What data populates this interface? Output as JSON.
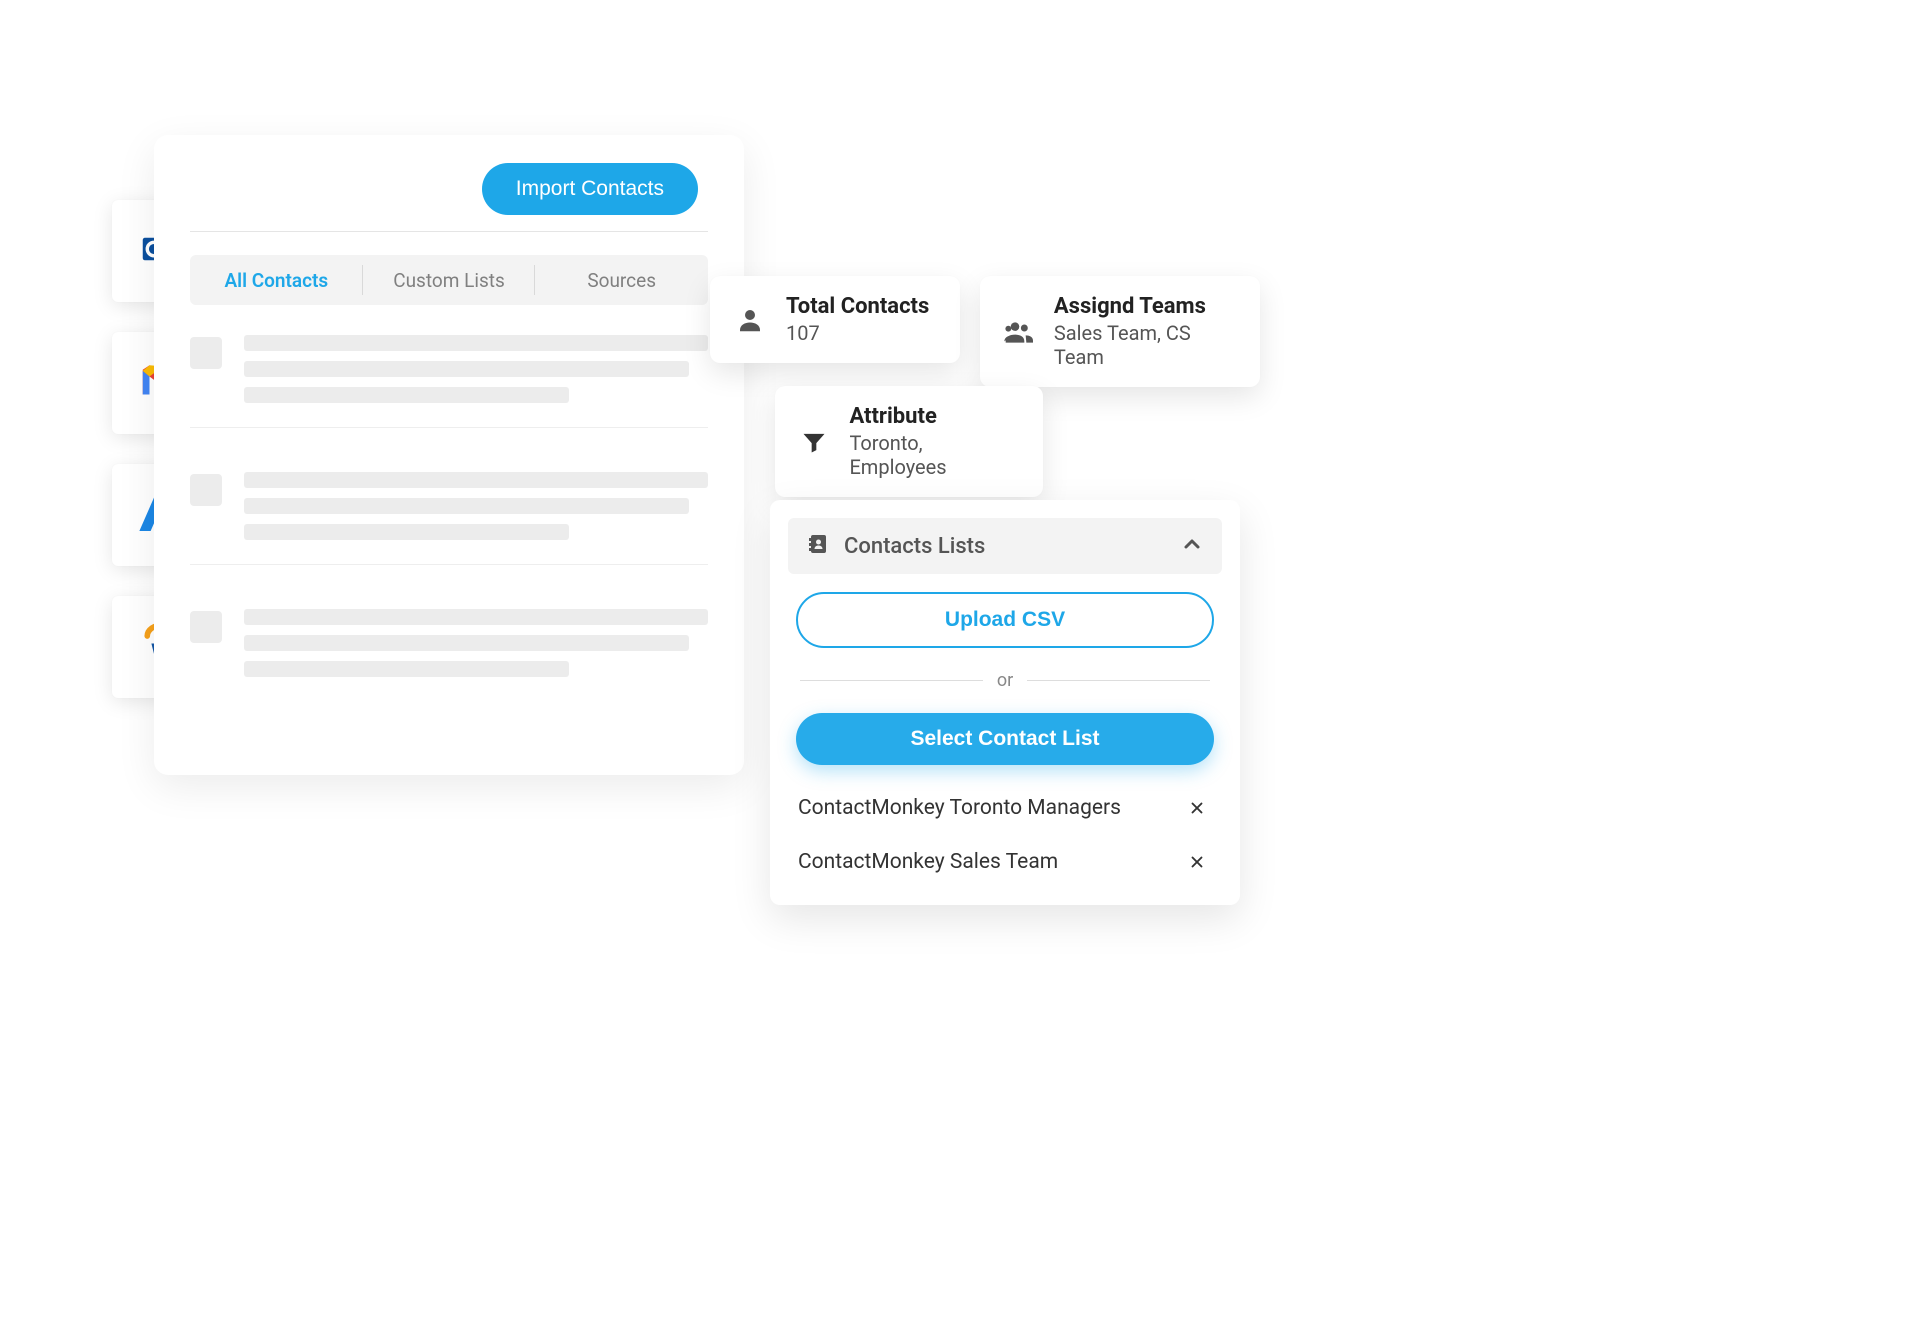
{
  "integrations": [
    {
      "id": "outlook",
      "name": "Outlook"
    },
    {
      "id": "gmail",
      "name": "Gmail"
    },
    {
      "id": "azure",
      "name": "Azure"
    },
    {
      "id": "workday",
      "name": "Workday"
    }
  ],
  "contacts_card": {
    "import_button": "Import Contacts",
    "tabs": {
      "all": "All Contacts",
      "custom": "Custom Lists",
      "sources": "Sources"
    }
  },
  "stats": {
    "total": {
      "label": "Total Contacts",
      "value": "107"
    },
    "teams": {
      "label": "Assignd Teams",
      "value": "Sales Team, CS Team"
    },
    "attribute": {
      "label": "Attribute",
      "value": "Toronto, Employees"
    }
  },
  "lists_panel": {
    "title": "Contacts Lists",
    "upload_label": "Upload CSV",
    "or_label": "or",
    "select_label": "Select Contact List",
    "selected": [
      "ContactMonkey Toronto Managers",
      "ContactMonkey Sales Team"
    ]
  }
}
